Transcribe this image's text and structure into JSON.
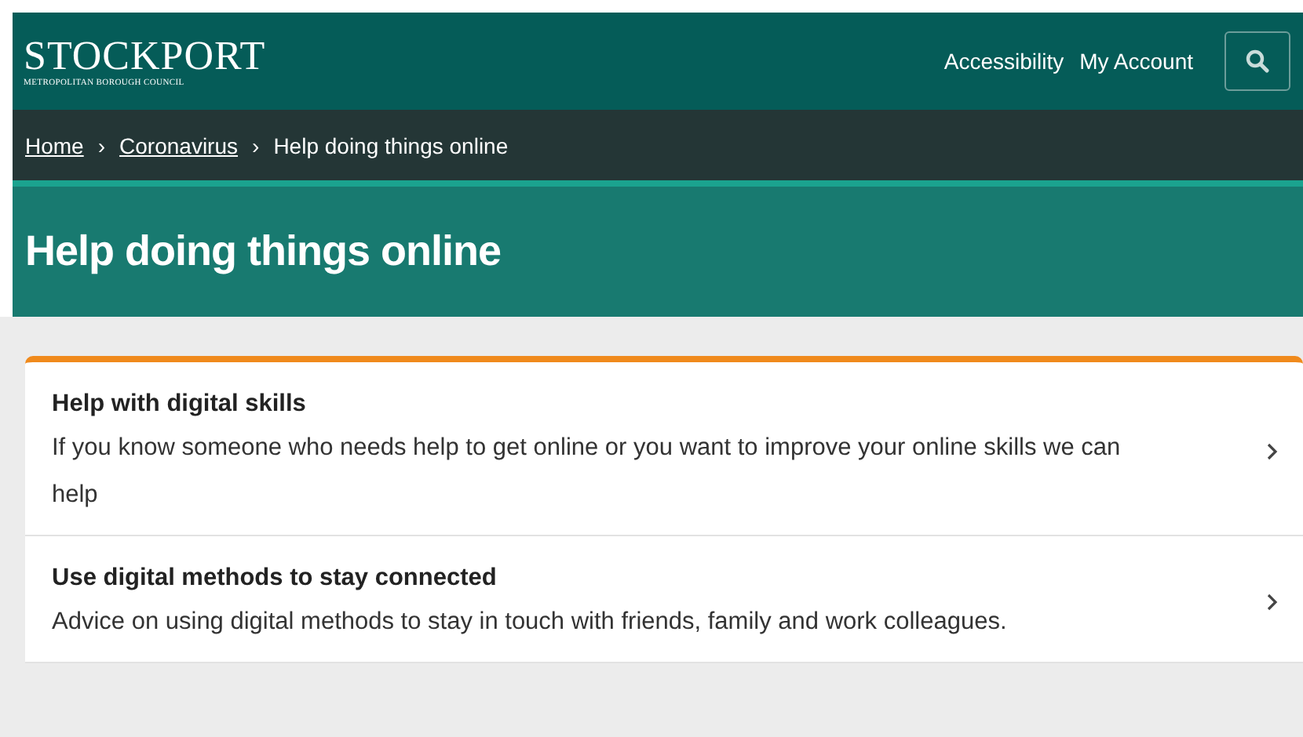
{
  "header": {
    "logo_title": "STOCKPORT",
    "logo_subtitle": "METROPOLITAN BOROUGH COUNCIL",
    "links": [
      "Accessibility",
      "My Account"
    ]
  },
  "breadcrumbs": [
    {
      "label": "Home",
      "link": true
    },
    {
      "label": "Coronavirus",
      "link": true
    },
    {
      "label": "Help doing things online",
      "link": false
    }
  ],
  "breadcrumb_separator": "›",
  "page_title": "Help doing things online",
  "items": [
    {
      "title": "Help with digital skills",
      "description": "If you know someone who needs help to get online or you want to improve your online skills we can help"
    },
    {
      "title": "Use digital methods to stay connected",
      "description": "Advice on using digital methods to stay in touch with friends, family and work colleagues."
    }
  ]
}
